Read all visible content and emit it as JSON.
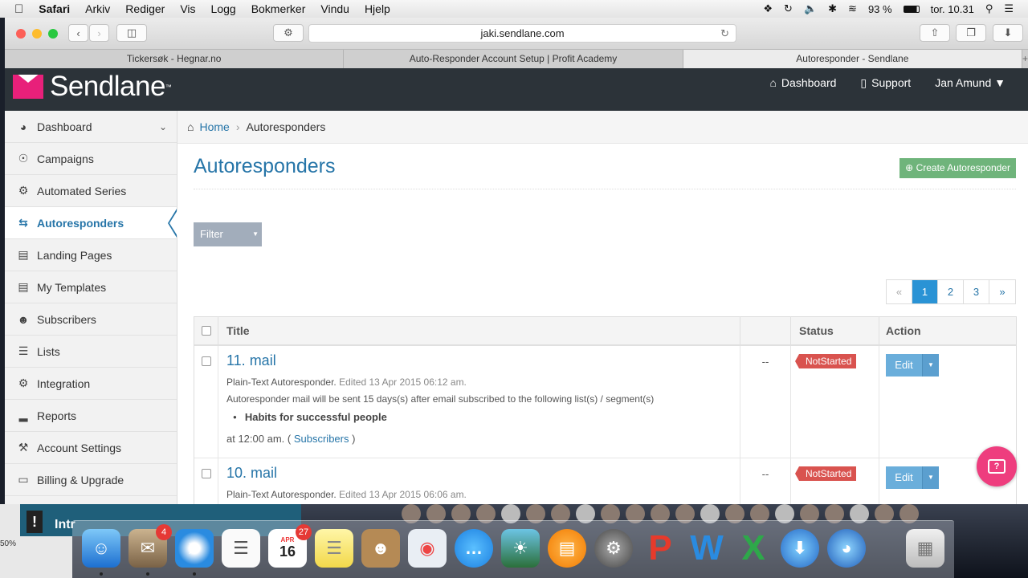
{
  "menubar": {
    "app": "Safari",
    "items": [
      "Arkiv",
      "Rediger",
      "Vis",
      "Logg",
      "Bokmerker",
      "Vindu",
      "Hjelp"
    ],
    "battery": "93 %",
    "clock": "tor. 10.31"
  },
  "browser": {
    "url": "jaki.sendlane.com",
    "tabs": [
      {
        "label": "Tickersøk - Hegnar.no"
      },
      {
        "label": "Auto-Responder Account Setup | Profit Academy"
      },
      {
        "label": "Autoresponder - Sendlane"
      }
    ]
  },
  "header": {
    "logo": "Sendlane",
    "nav": {
      "dashboard": "Dashboard",
      "support": "Support",
      "user": "Jan Amund"
    }
  },
  "sidebar": {
    "items": [
      {
        "label": "Dashboard",
        "icon": "dashboard-icon"
      },
      {
        "label": "Campaigns",
        "icon": "compass-icon"
      },
      {
        "label": "Automated Series",
        "icon": "gears-icon"
      },
      {
        "label": "Autoresponders",
        "icon": "retweet-icon"
      },
      {
        "label": "Landing Pages",
        "icon": "rss-icon"
      },
      {
        "label": "My Templates",
        "icon": "file-icon"
      },
      {
        "label": "Subscribers",
        "icon": "user-plus-icon"
      },
      {
        "label": "Lists",
        "icon": "list-icon"
      },
      {
        "label": "Integration",
        "icon": "gear-icon"
      },
      {
        "label": "Reports",
        "icon": "signal-icon"
      },
      {
        "label": "Account Settings",
        "icon": "wrench-icon"
      },
      {
        "label": "Billing & Upgrade",
        "icon": "credit-card-icon"
      }
    ]
  },
  "breadcrumb": {
    "home": "Home",
    "current": "Autoresponders"
  },
  "main": {
    "title": "Autoresponders",
    "create_label": "Create Autoresponder",
    "filter_label": "Filter"
  },
  "pagination": {
    "prev": "«",
    "pages": [
      "1",
      "2",
      "3"
    ],
    "next": "»",
    "active": "1"
  },
  "table": {
    "headers": {
      "title": "Title",
      "status": "Status",
      "action": "Action"
    },
    "rows": [
      {
        "title": "11. mail",
        "type": "Plain-Text Autoresponder.",
        "edited": "Edited 13 Apr 2015 06:12 am.",
        "description": "Autoresponder mail will be sent 15 days(s) after email subscribed to the following list(s) / segment(s)",
        "list": "Habits for successful people",
        "at": "at 12:00 am. (",
        "subscribers": "Subscribers",
        "at_end": ")",
        "dash": "--",
        "status": "NotStarted",
        "action": "Edit"
      },
      {
        "title": "10. mail",
        "type": "Plain-Text Autoresponder.",
        "edited": "Edited 13 Apr 2015 06:06 am.",
        "dash": "--",
        "status": "NotStarted",
        "action": "Edit"
      }
    ]
  },
  "desktop": {
    "zoom": "50%",
    "window_title": "Intr",
    "dock_badges": {
      "mail": "4",
      "calendar": "27"
    },
    "calendar_month": "APR",
    "calendar_day": "16"
  }
}
